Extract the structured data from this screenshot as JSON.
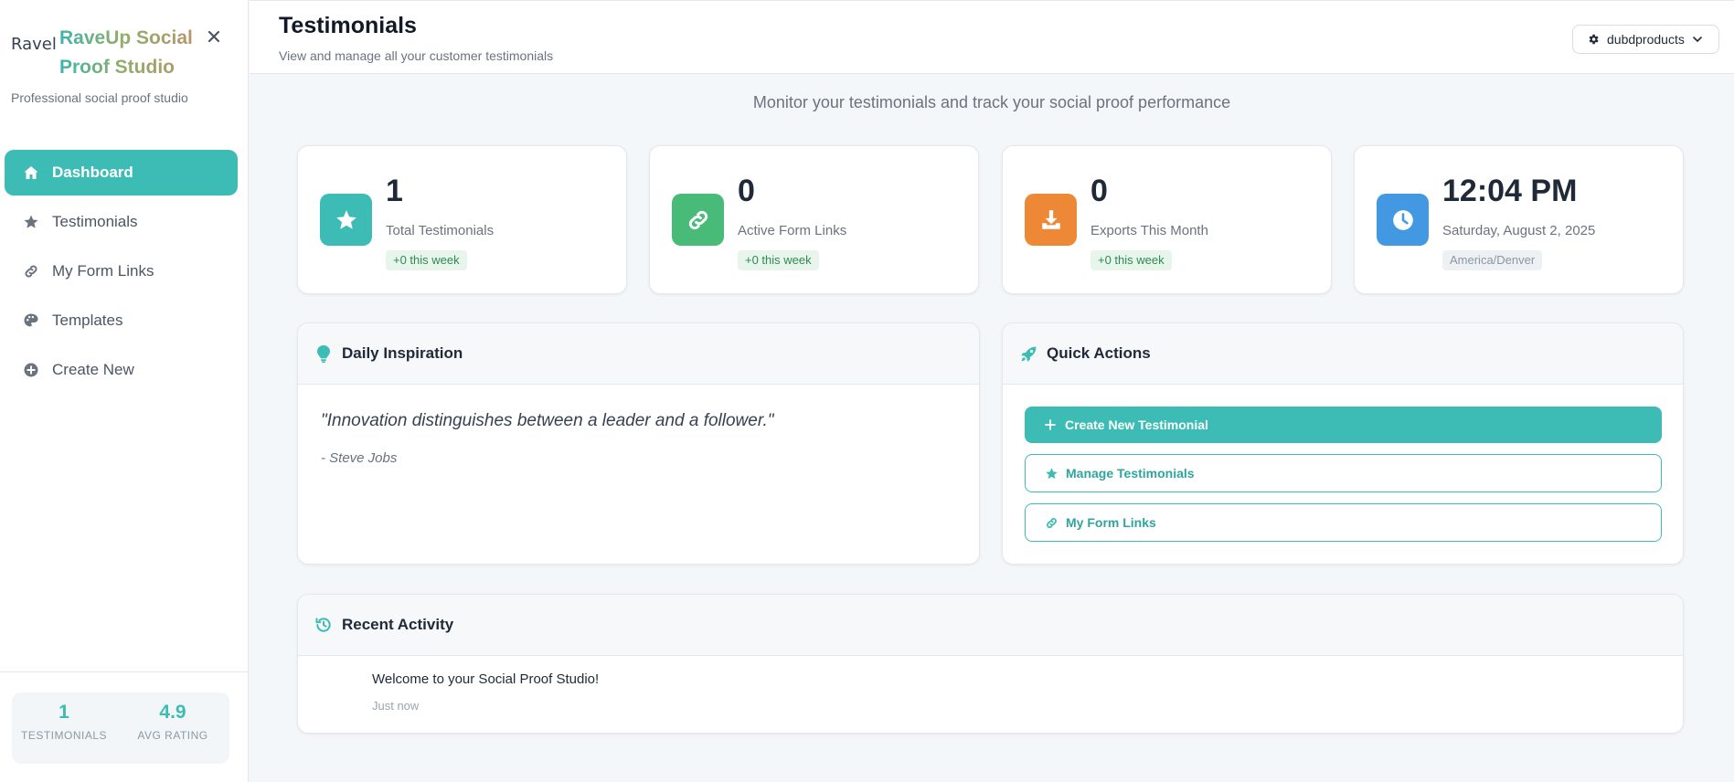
{
  "brand": {
    "logo_alt": "Ravel",
    "name": "RaveUp Social Proof Studio",
    "subtitle": "Professional social proof studio"
  },
  "sidebar": {
    "items": [
      {
        "label": "Dashboard",
        "icon": "home-icon",
        "active": true
      },
      {
        "label": "Testimonials",
        "icon": "star-icon",
        "active": false
      },
      {
        "label": "My Form Links",
        "icon": "link-icon",
        "active": false
      },
      {
        "label": "Templates",
        "icon": "palette-icon",
        "active": false
      },
      {
        "label": "Create New",
        "icon": "plus-circle-icon",
        "active": false
      }
    ],
    "stats": [
      {
        "value": "1",
        "label": "TESTIMONIALS"
      },
      {
        "value": "4.9",
        "label": "AVG RATING"
      }
    ]
  },
  "header": {
    "title": "Testimonials",
    "subtitle": "View and manage all your customer testimonials",
    "account": "dubdproducts"
  },
  "tagline": "Monitor your testimonials and track your social proof performance",
  "stat_cards": [
    {
      "value": "1",
      "label": "Total Testimonials",
      "badge": "+0 this week",
      "icon": "star-icon",
      "color": "#3dbcb5"
    },
    {
      "value": "0",
      "label": "Active Form Links",
      "badge": "+0 this week",
      "icon": "link-icon",
      "color": "#48bb78"
    },
    {
      "value": "0",
      "label": "Exports This Month",
      "badge": "+0 this week",
      "icon": "download-icon",
      "color": "#ed8936"
    },
    {
      "value": "12:04 PM",
      "label": "Saturday, August 2, 2025",
      "badge": "America/Denver",
      "icon": "clock-icon",
      "color": "#4299e1"
    }
  ],
  "inspiration": {
    "title": "Daily Inspiration",
    "quote": "\"Innovation distinguishes between a leader and a follower.\"",
    "author": "- Steve Jobs"
  },
  "quick_actions": {
    "title": "Quick Actions",
    "create": "Create New Testimonial",
    "manage": "Manage Testimonials",
    "links": "My Form Links"
  },
  "recent_activity": {
    "title": "Recent Activity",
    "items": [
      {
        "text": "Welcome to your Social Proof Studio!",
        "time": "Just now"
      }
    ]
  },
  "colors": {
    "accent": "#3dbcb5"
  }
}
